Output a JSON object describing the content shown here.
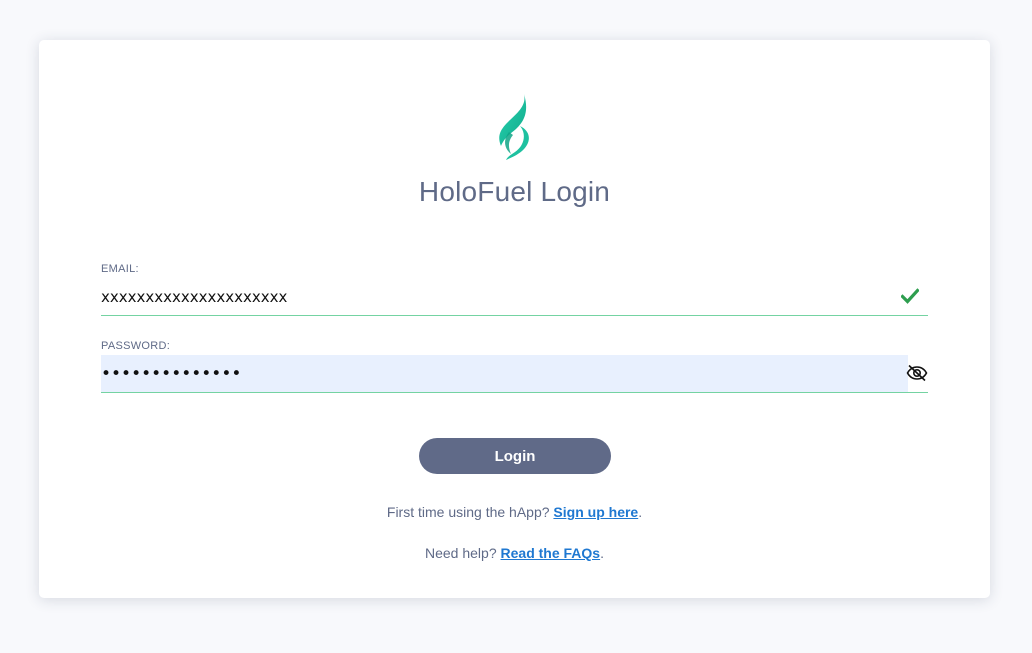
{
  "title": "HoloFuel Login",
  "logo": {
    "icon": "holo-flame-logo-icon",
    "color": "#1ec1a0"
  },
  "email": {
    "label": "EMAIL:",
    "value": "xxxxxxxxxxxxxxxxxxxxx",
    "status_icon": "check-icon",
    "status_color": "#2e9e4f"
  },
  "password": {
    "label": "PASSWORD:",
    "value": "passwordpasswo",
    "toggle_icon": "eye-slash-icon"
  },
  "login_button": {
    "label": "Login",
    "color": "#606a88"
  },
  "signup": {
    "prefix": "First time using the hApp? ",
    "link": "Sign up here",
    "suffix": "."
  },
  "faq": {
    "prefix": "Need help? ",
    "link": "Read the FAQs",
    "suffix": "."
  },
  "colors": {
    "background": "#f8f9fc",
    "text": "#5f6a87",
    "link": "#1f78d1",
    "input_underline": "#74d3a2",
    "autofill_background": "#e8f0fe"
  }
}
